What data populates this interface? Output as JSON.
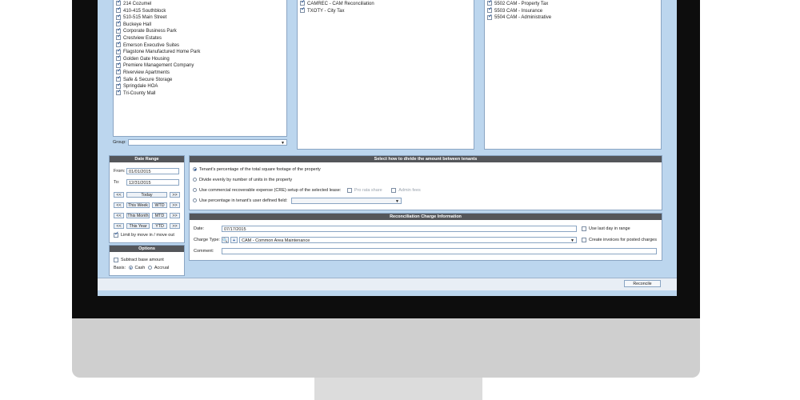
{
  "properties": [
    "214 Cozumel",
    "410-415 Southblock",
    "510-515 Main Street",
    "Buckeye Hall",
    "Corporate Business Park",
    "Crestview Estates",
    "Emerson Executive Suites",
    "Flagstone Manufactured Home Park",
    "Golden Gate Housing",
    "Premiere Management Company",
    "Riverview Apartments",
    "Safe & Secure Storage",
    "Springdale HOA",
    "Tri-County Mall"
  ],
  "charge_codes_mid": [
    "CAMREC - CAM Reconciliation",
    "TXOTY - City Tax"
  ],
  "charge_codes_right": [
    "5502 CAM - Property Tax",
    "5503 CAM - Insurance",
    "5504 CAM - Administrative"
  ],
  "group_label": "Group:",
  "date_range": {
    "title": "Date Range",
    "from_label": "From:",
    "from_value": "01/01/2015",
    "to_label": "To:",
    "to_value": "12/31/2015",
    "prev": "<<",
    "next": ">>",
    "today": "Today",
    "this_week": "This Week",
    "wtd": "WTD",
    "this_month": "This Month",
    "mtd": "MTD",
    "this_year": "This Year",
    "ytd": "YTD",
    "limit_label": "Limit by move in / move out"
  },
  "options": {
    "title": "Options",
    "subtract_label": "Subtract base amount",
    "basis_label": "Basis:",
    "cash": "Cash",
    "accrual": "Accrual"
  },
  "divide": {
    "title": "Select how to divide the amount between tenants",
    "opt1": "Tenant's percentage of the total square footage of the property",
    "opt2": "Divide evenly by number of units in the property",
    "opt3": "Use commercial recoverable expense (CRE)  setup of the selected lease:",
    "pro_rata": "Pro rata share",
    "admin_fees": "Admin fees",
    "opt4": "Use percentage in tenant's user defined field:"
  },
  "recon": {
    "title": "Reconciliation Charge Information",
    "date_label": "Date:",
    "date_value": "07/17/2015",
    "charge_label": "Charge Type:",
    "charge_value": "CAM - Common Area Maintenance",
    "comment_label": "Comment:",
    "last_day": "Use last day in range",
    "create_invoices": "Create invoices for posted charges"
  },
  "reconcile_button": "Reconcile"
}
